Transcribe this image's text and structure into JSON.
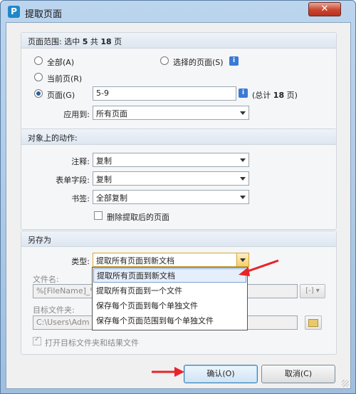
{
  "window": {
    "title": "提取页面",
    "app_icon_letter": "P",
    "close_glyph": "✕"
  },
  "page_range": {
    "header_prefix": "页面范围: 选中 ",
    "selected": "5",
    "header_mid": " 共 ",
    "total": "18",
    "header_suffix": " 页",
    "all_label": "全部(A)",
    "selected_pages_label": "选择的页面(S)",
    "current_label": "当前页(R)",
    "pages_label": "页面(G)",
    "pages_value": "5-9",
    "total_note_prefix": "(总计 ",
    "total_note_suffix": " 页)",
    "apply_label": "应用到:",
    "apply_value": "所有页面",
    "info_glyph": "i"
  },
  "actions": {
    "header": "对象上的动作:",
    "annotation_label": "注释:",
    "annotation_value": "复制",
    "form_label": "表单字段:",
    "form_value": "复制",
    "bookmark_label": "书签:",
    "bookmark_value": "全部复制",
    "delete_label": "删除提取后的页面"
  },
  "save_as": {
    "header": "另存为",
    "type_label": "类型:",
    "type_value": "提取所有页面到新文档",
    "options": [
      "提取所有页面到新文档",
      "提取所有页面到一个文件",
      "保存每个页面到每个单独文件",
      "保存每个页面范围到每个单独文件"
    ],
    "filename_label": "文件名:",
    "filename_value": "%[FileName]_%",
    "macro_glyph": "[-]",
    "folder_label": "目标文件夹:",
    "folder_value": "C:\\Users\\Adm",
    "open_label": "打开目标文件夹和结果文件"
  },
  "buttons": {
    "ok": "确认(O)",
    "cancel": "取消(C)"
  },
  "colors": {
    "arrow": "#e8242a",
    "accent": "#3c7fb1"
  }
}
